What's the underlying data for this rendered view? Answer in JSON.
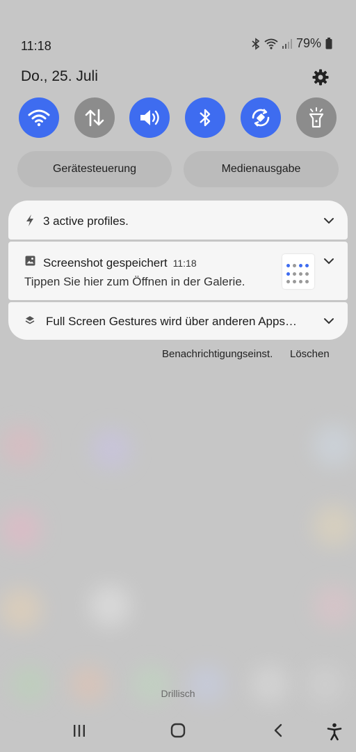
{
  "status_bar": {
    "time": "11:18",
    "battery_percent": "79%",
    "icons": [
      "bluetooth-icon",
      "wifi-icon",
      "signal-icon",
      "battery-icon"
    ]
  },
  "header": {
    "date": "Do., 25. Juli",
    "settings_icon": "gear-icon"
  },
  "quick_settings": [
    {
      "name": "wifi",
      "icon": "wifi-icon",
      "state": "on"
    },
    {
      "name": "mobile-data",
      "icon": "data-arrows-icon",
      "state": "off"
    },
    {
      "name": "sound",
      "icon": "volume-icon",
      "state": "on"
    },
    {
      "name": "bluetooth",
      "icon": "bluetooth-icon",
      "state": "on"
    },
    {
      "name": "auto-rotate",
      "icon": "rotate-icon",
      "state": "on"
    },
    {
      "name": "flashlight",
      "icon": "flashlight-icon",
      "state": "off"
    }
  ],
  "buttons": {
    "device_control": "Gerätesteuerung",
    "media_output": "Medienausgabe"
  },
  "notifications": [
    {
      "icon": "bolt-icon",
      "title": "3 active profiles."
    },
    {
      "icon": "image-icon",
      "title": "Screenshot gespeichert",
      "time": "11:18",
      "text": "Tippen Sie hier zum Öffnen in der Galerie."
    },
    {
      "icon": "layers-icon",
      "title": "Full Screen Gestures wird über anderen Apps…"
    }
  ],
  "notification_actions": {
    "settings": "Benachrichtigungseinst.",
    "clear": "Löschen"
  },
  "carrier": "Drillisch",
  "navigation": [
    "recent-apps-icon",
    "home-icon",
    "back-icon",
    "accessibility-icon"
  ],
  "colors": {
    "accent": "#3e6cf0",
    "tile_off": "#8c8c8c",
    "card_bg": "#f6f6f6",
    "background": "#c6c6c6"
  }
}
